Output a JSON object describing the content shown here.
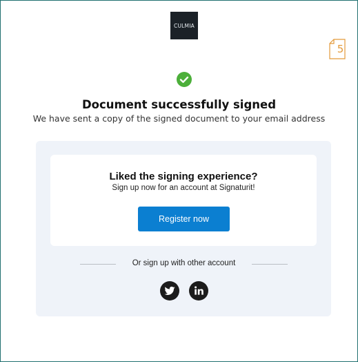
{
  "logo": {
    "text": "CULMIA"
  },
  "page_badge": {
    "number": "5"
  },
  "status": {
    "title": "Document successfully signed",
    "message": "We have sent a copy of the signed document to your email address"
  },
  "signup": {
    "title": "Liked the signing experience?",
    "subtitle": "Sign up now for an account at Signaturit!",
    "register_label": "Register now",
    "divider_text": "Or sign up with other account"
  },
  "social": [
    "twitter-icon",
    "linkedin-icon"
  ],
  "colors": {
    "accent": "#0b7fd1",
    "success": "#4caf3a",
    "panel_bg": "#eff3f9",
    "badge": "#e39a3b"
  }
}
